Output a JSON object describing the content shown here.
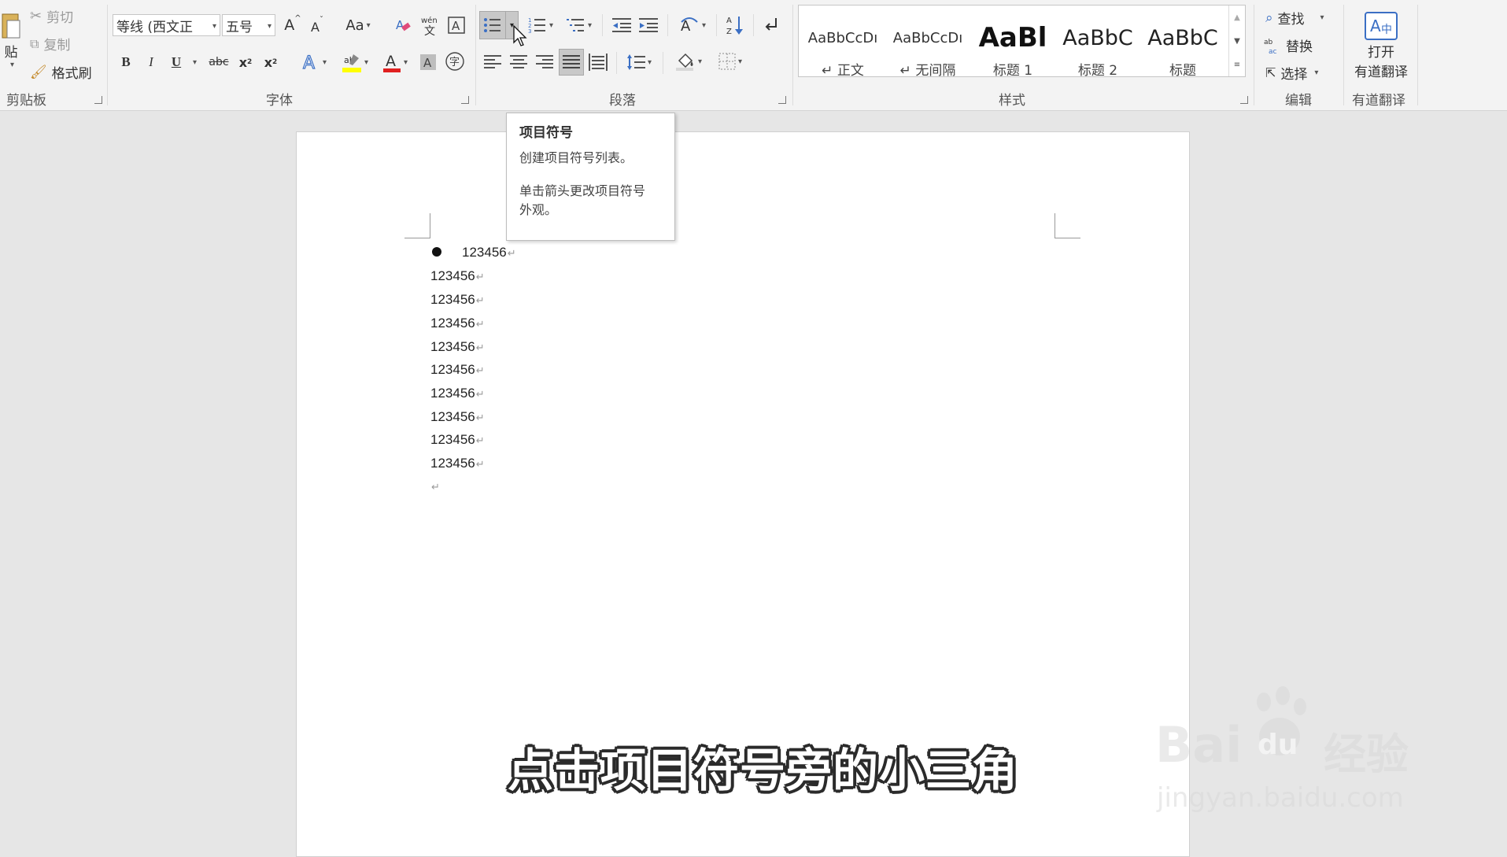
{
  "ribbon": {
    "clipboard": {
      "paste_label": "贴",
      "cut_label": "剪切",
      "copy_label": "复制",
      "format_painter_label": "格式刷",
      "group_label": "剪贴板"
    },
    "font": {
      "font_name": "等线 (西文正​",
      "font_size": "五号",
      "grow_font": "A",
      "shrink_font": "A",
      "change_case": "Aa",
      "bold": "B",
      "italic": "I",
      "underline": "U",
      "strike": "abc",
      "subscript": "x",
      "superscript": "x",
      "group_label": "字体",
      "font_color": "#e02020",
      "highlight_color": "#ffff00"
    },
    "paragraph": {
      "group_label": "段落"
    },
    "styles": {
      "group_label": "样式",
      "items": [
        {
          "sample": "AaBbCcDı",
          "name": "↵ 正文"
        },
        {
          "sample": "AaBbCcDı",
          "name": "↵ 无间隔"
        },
        {
          "sample": "AaBl",
          "name": "标题 1"
        },
        {
          "sample": "AaBbC",
          "name": "标题 2"
        },
        {
          "sample": "AaBbC",
          "name": "标题"
        }
      ]
    },
    "editing": {
      "find": "查找",
      "replace": "替换",
      "select": "选择",
      "group_label": "编辑"
    },
    "youdao": {
      "open_line1": "打开",
      "open_line2": "有道翻译",
      "group_label": "有道翻译"
    }
  },
  "tooltip": {
    "title": "项目符号",
    "line1": "创建项目符号列表。",
    "line2": "单击箭头更改项目符号",
    "line3": "外观。"
  },
  "document": {
    "lines": [
      "123456",
      "123456",
      "123456",
      "123456",
      "123456",
      "123456",
      "123456",
      "123456",
      "123456",
      "123456"
    ],
    "para_mark": "↵"
  },
  "caption": "点击项目符号旁的小三角",
  "watermark": {
    "logo_text": "Bai",
    "logo_text2": "du",
    "brand_cn": "经验",
    "url": "jingyan.baidu.com"
  },
  "colors": {
    "accent": "#2b579a"
  }
}
